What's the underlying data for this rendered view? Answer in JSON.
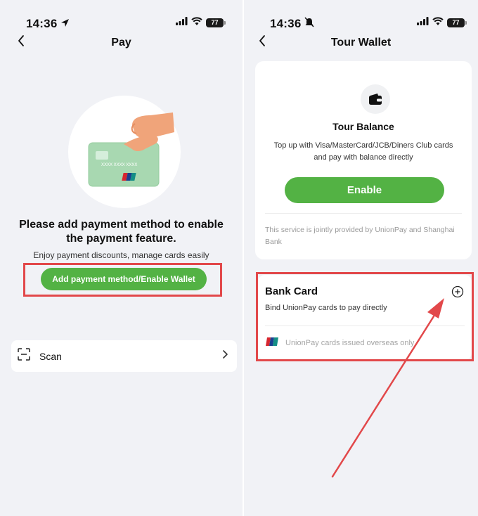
{
  "left_screen": {
    "status": {
      "time": "14:36",
      "battery": "77"
    },
    "nav": {
      "title": "Pay"
    },
    "card_number": "XXXX XXXX XXXX",
    "headline": "Please add payment method to enable the payment feature.",
    "subline": "Enjoy payment discounts, manage cards easily",
    "primary_button": "Add payment method/Enable Wallet",
    "scan": {
      "label": "Scan"
    }
  },
  "right_screen": {
    "status": {
      "time": "14:36",
      "battery": "77"
    },
    "nav": {
      "title": "Tour Wallet"
    },
    "wallet": {
      "title": "Tour Balance",
      "description": "Top up with Visa/MasterCard/JCB/Diners Club cards and pay with balance directly",
      "button": "Enable",
      "note": "This service is jointly provided by UnionPay and Shanghai Bank"
    },
    "bank_card": {
      "title": "Bank Card",
      "description": "Bind UnionPay cards to pay directly",
      "item_label": "UnionPay cards issued overseas only"
    }
  },
  "colors": {
    "accent_green": "#53b244",
    "highlight_red": "#e2484a",
    "background": "#f1f2f6"
  },
  "icons": [
    "location-arrow-icon",
    "bell-muted-icon",
    "signal-icon",
    "wifi-icon",
    "battery-icon",
    "back-chevron-icon",
    "scan-icon",
    "chevron-right-icon",
    "wallet-icon",
    "add-circle-icon",
    "unionpay-logo-icon"
  ]
}
